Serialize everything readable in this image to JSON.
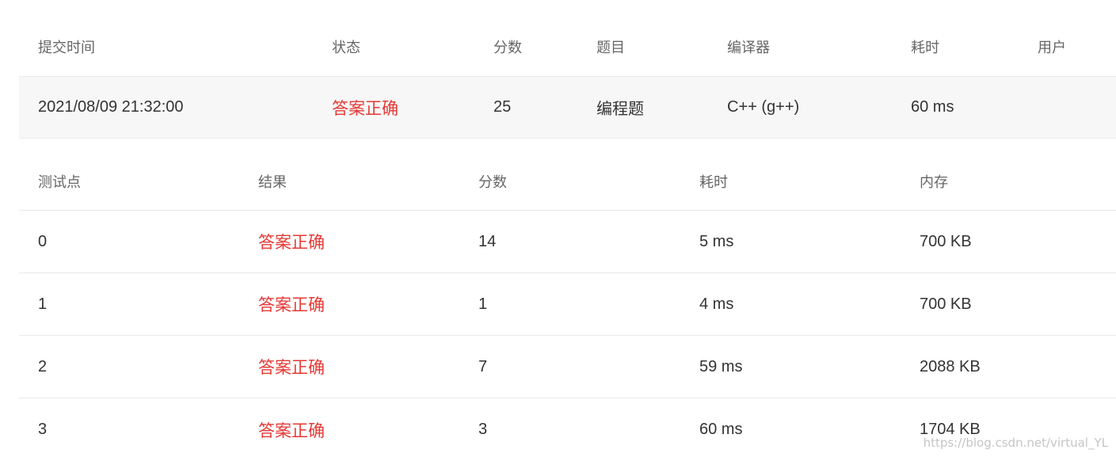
{
  "submission": {
    "headers": [
      "提交时间",
      "状态",
      "分数",
      "题目",
      "编译器",
      "耗时",
      "用户"
    ],
    "row": {
      "time": "2021/08/09 21:32:00",
      "status": "答案正确",
      "score": "25",
      "problem": "编程题",
      "compiler": "C++ (g++)",
      "duration": "60 ms",
      "user": ""
    }
  },
  "testcases": {
    "headers": [
      "测试点",
      "结果",
      "分数",
      "耗时",
      "内存"
    ],
    "rows": [
      {
        "id": "0",
        "result": "答案正确",
        "score": "14",
        "time": "5 ms",
        "memory": "700 KB"
      },
      {
        "id": "1",
        "result": "答案正确",
        "score": "1",
        "time": "4 ms",
        "memory": "700 KB"
      },
      {
        "id": "2",
        "result": "答案正确",
        "score": "7",
        "time": "59 ms",
        "memory": "2088 KB"
      },
      {
        "id": "3",
        "result": "答案正确",
        "score": "3",
        "time": "60 ms",
        "memory": "1704 KB"
      }
    ]
  },
  "watermark": "https://blog.csdn.net/virtual_YL",
  "colors": {
    "accepted": "#e53935",
    "header_text": "#666666",
    "body_text": "#333333",
    "highlight_row_bg": "#f7f7f7"
  }
}
